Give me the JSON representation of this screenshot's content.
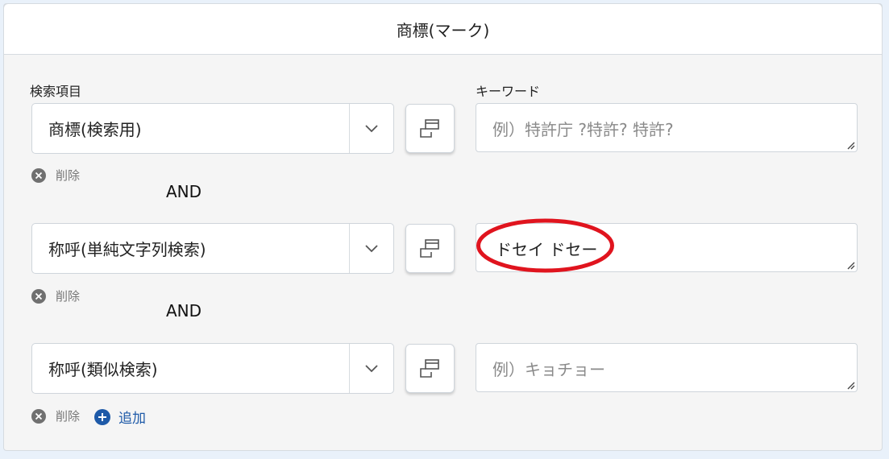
{
  "header": {
    "title": "商標(マーク)"
  },
  "labels": {
    "search_item": "検索項目",
    "keyword": "キーワード"
  },
  "rows": [
    {
      "field": "商標(検索用)",
      "keyword_value": "",
      "placeholder": "例）特許庁 ?特許? 特許?",
      "delete_label": "削除"
    },
    {
      "field": "称呼(単純文字列検索)",
      "keyword_value": "ドセイ ドセー",
      "placeholder": "",
      "delete_label": "削除"
    },
    {
      "field": "称呼(類似検索)",
      "keyword_value": "",
      "placeholder": "例）キョチョー",
      "delete_label": "削除"
    }
  ],
  "operators": [
    "AND",
    "AND"
  ],
  "add_label": "追加",
  "colors": {
    "accent_blue": "#1e5aa8",
    "highlight_red": "#e0141e"
  },
  "icons": {
    "select": "chevron-down-icon",
    "popup": "window-popup-icon",
    "delete": "close-circle-icon",
    "add": "plus-circle-icon"
  }
}
